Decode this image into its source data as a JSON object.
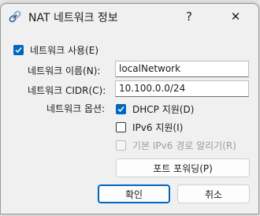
{
  "dialog": {
    "title": "NAT 네트워크 정보",
    "help_label": "?",
    "close_label": "✕"
  },
  "enable_network": {
    "label": "네트워크 사용(E)",
    "checked": true
  },
  "fields": {
    "name_label": "네트워크 이름(N):",
    "name_value": "localNetwork",
    "cidr_label": "네트워크 CIDR(C):",
    "cidr_value": "10.100.0.0/24",
    "options_label": "네트워크 옵션:"
  },
  "options": {
    "dhcp_label": "DHCP 지원(D)",
    "dhcp_checked": true,
    "ipv6_label": "IPv6 지원(I)",
    "ipv6_checked": false,
    "ipv6_route_label": "기본 IPv6 경로 알리기(R)",
    "ipv6_route_checked": false,
    "ipv6_route_disabled": true
  },
  "buttons": {
    "port_forwarding": "포트 포워딩(P)",
    "ok": "확인",
    "cancel": "취소"
  },
  "colors": {
    "accent": "#0067c0",
    "window_bg": "#f0f0f0",
    "disabled_text": "#9c9c9c"
  }
}
